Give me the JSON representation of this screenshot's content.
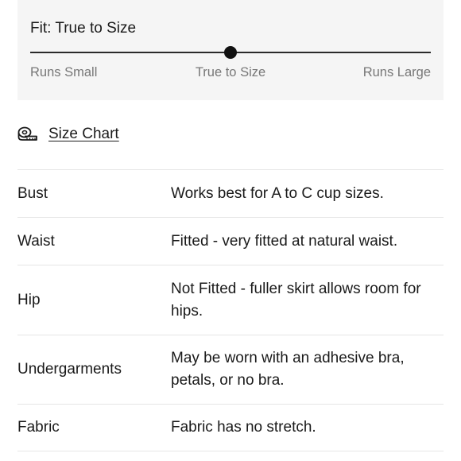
{
  "fit": {
    "title": "Fit: True to Size",
    "labels": {
      "small": "Runs Small",
      "true": "True to Size",
      "large": "Runs Large"
    },
    "position": 0.5
  },
  "size_chart": {
    "label": "Size Chart",
    "icon": "measuring-tape-icon"
  },
  "details": [
    {
      "key": "Bust",
      "value": "Works best for A to C cup sizes."
    },
    {
      "key": "Waist",
      "value": "Fitted - very fitted at natural waist."
    },
    {
      "key": "Hip",
      "value": "Not Fitted - fuller skirt allows room for hips."
    },
    {
      "key": "Undergarments",
      "value": "May be worn with an adhesive bra, petals, or no bra."
    },
    {
      "key": "Fabric",
      "value": "Fabric has no stretch."
    }
  ]
}
